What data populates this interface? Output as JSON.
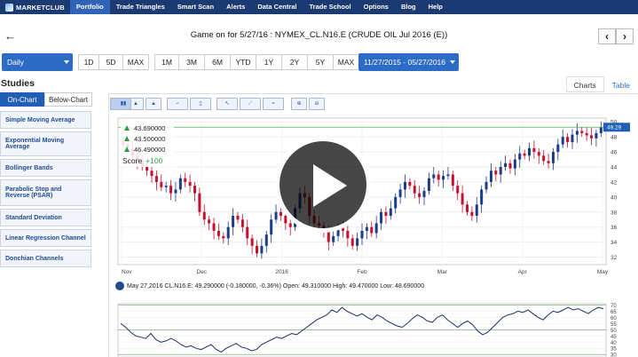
{
  "nav": {
    "logo": "MARKETCLUB",
    "items": [
      "Portfolio",
      "Trade Triangles",
      "Smart Scan",
      "Alerts",
      "Data Central",
      "Trade School",
      "Options",
      "Blog",
      "Help"
    ]
  },
  "header": {
    "title": "Game on for 5/27/16 : NYMEX_CL.N16.E (CRUDE OIL Jul 2016 (E))"
  },
  "toolbar": {
    "interval": "Daily",
    "intraday_ranges": [
      "1D",
      "5D",
      "MAX"
    ],
    "ranges": [
      "1M",
      "3M",
      "6M",
      "YTD",
      "1Y",
      "2Y",
      "5Y",
      "MAX"
    ],
    "date_range": "11/27/2015 - 05/27/2016"
  },
  "studies": {
    "heading": "Studies",
    "tabs": [
      "On-Chart",
      "Below-Chart"
    ],
    "items": [
      "Simple Moving Average",
      "Exponential Moving Average",
      "Bollinger Bands",
      "Parabolic Stop and Reverse (PSAR)",
      "Standard Deviation",
      "Linear Regression Channel",
      "Donchian Channels"
    ]
  },
  "view_tabs": [
    "Charts",
    "Table"
  ],
  "score_box": {
    "levels": [
      "43.690000",
      "43.500000",
      "46.490000"
    ],
    "score_label": "Score",
    "score_value": "+100"
  },
  "quote": "May 27,2016 CL.N16.E: 49.290000 (-0.180000, -0.36%) Open: 49.310000 High: 49.470000 Low: 48.690000",
  "chart_data": [
    {
      "type": "candlestick",
      "x_tick_labels": [
        "Nov",
        "Dec",
        "2016",
        "Feb",
        "Mar",
        "Apr",
        "May"
      ],
      "y_tick_labels": [
        "50",
        "48",
        "46",
        "44",
        "42",
        "40",
        "38",
        "36",
        "34",
        "32"
      ],
      "ylim": [
        31,
        50.5
      ],
      "last_price_label": "49.29",
      "series_close": [
        47,
        46.5,
        45.5,
        44.8,
        44,
        43.5,
        42.8,
        42,
        41.3,
        41.5,
        40.5,
        41,
        42.5,
        42,
        41.5,
        40.5,
        38,
        37,
        36.5,
        35.5,
        34.8,
        34.5,
        36,
        37.5,
        37,
        36,
        34.5,
        33.5,
        32.5,
        33.5,
        35,
        37,
        38,
        37.5,
        36.5,
        36,
        38.5,
        40.5,
        40,
        37.5,
        36.5,
        36.2,
        35.5,
        34,
        34.8,
        36,
        35.5,
        34.5,
        33.5,
        34.5,
        35.5,
        36,
        35.2,
        36.5,
        38,
        37.5,
        38.5,
        40,
        41,
        42,
        41.5,
        40.5,
        40,
        40.8,
        42.5,
        43,
        42.3,
        42.8,
        43,
        41.5,
        40.5,
        39,
        38,
        37.5,
        39,
        41,
        42,
        43.5,
        43,
        44,
        44.5,
        43.8,
        45,
        45.8,
        45.5,
        46.5,
        46,
        45.5,
        44.8,
        44.5,
        46,
        47,
        48,
        47.3,
        48.3,
        48.8,
        48.5,
        48.2,
        47.8,
        48.5,
        49.29
      ]
    },
    {
      "type": "line",
      "y_tick_labels": [
        "70",
        "65",
        "60",
        "55",
        "50",
        "45",
        "40",
        "35",
        "30"
      ],
      "ylim": [
        28,
        71
      ],
      "values": [
        55,
        52,
        48,
        45,
        44,
        43,
        47,
        42,
        40,
        41,
        43,
        41,
        38,
        36,
        37,
        35,
        34,
        36,
        38,
        34,
        32,
        35,
        37,
        39,
        36,
        35,
        33,
        34,
        38,
        40,
        42,
        44,
        43,
        45,
        47,
        46,
        49,
        52,
        55,
        58,
        60,
        62,
        66,
        64,
        68,
        65,
        63,
        61,
        63,
        60,
        58,
        62,
        60,
        57,
        55,
        53,
        52,
        55,
        59,
        62,
        60,
        57,
        56,
        60,
        62,
        58,
        55,
        52,
        55,
        57,
        54,
        49,
        46,
        48,
        52,
        56,
        60,
        62,
        63,
        65,
        64,
        66,
        63,
        60,
        58,
        62,
        65,
        64,
        66,
        68,
        66,
        67,
        65,
        63,
        66,
        68,
        67
      ]
    }
  ]
}
